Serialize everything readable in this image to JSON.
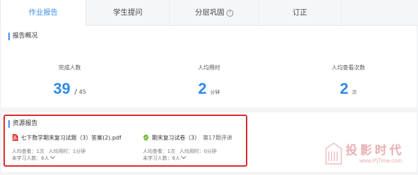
{
  "tabs": [
    {
      "label": "作业报告",
      "active": true
    },
    {
      "label": "学生提问",
      "active": false
    },
    {
      "label": "分层巩固",
      "active": false,
      "icon": "question-circle-icon"
    },
    {
      "label": "订正",
      "active": false
    }
  ],
  "overview": {
    "title": "报告概况",
    "stats": [
      {
        "label": "完成人数",
        "value": "39",
        "separator": "/",
        "total": "45"
      },
      {
        "label": "人均用时",
        "value": "2",
        "unit": "分钟"
      },
      {
        "label": "人均查看次数",
        "value": "2",
        "unit": "次"
      }
    ]
  },
  "resources": {
    "title": "资源报告",
    "items": [
      {
        "icon": "pdf-icon",
        "name": "七下数学期末复习试题（3）答案(2).pdf",
        "line1": {
          "views_label": "人均查看：",
          "views": "1次",
          "time_label": "人均用时：",
          "time": "1分钟"
        },
        "line2": {
          "label": "未学习人数：",
          "value": "6人"
        }
      },
      {
        "icon": "quiz-icon",
        "name": "期末复习试卷（3）",
        "meta": "第17题评讲",
        "line1": {
          "views_label": "人均查看：",
          "views": "1次",
          "time_label": "人均用时：",
          "time": "0分钟"
        },
        "line2": {
          "label": "未学习人数：",
          "value": "6人"
        }
      }
    ]
  },
  "watermark": {
    "text": "投影时代",
    "url": "www.PjTime.com"
  },
  "colors": {
    "accent": "#2f8ae5",
    "highlight_border": "#d9272e",
    "pdf_red": "#e0463d",
    "quiz_green": "#6cb52d"
  }
}
